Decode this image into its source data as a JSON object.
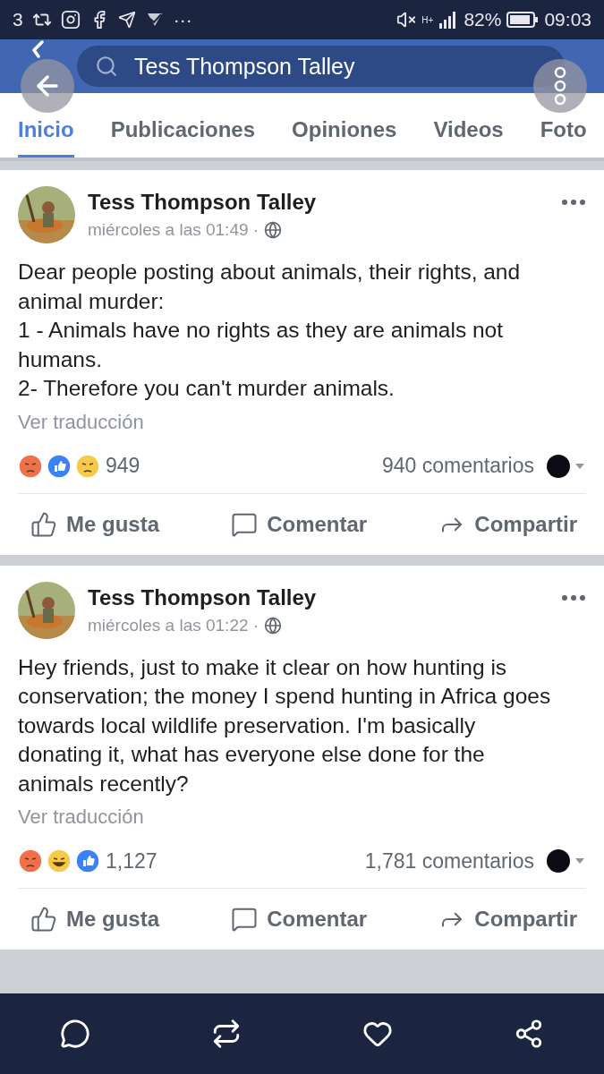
{
  "status_bar": {
    "notification_count": "3",
    "more": "···",
    "network": "H+",
    "battery": "82%",
    "time": "09:03"
  },
  "header": {
    "search": {
      "value": "Tess Thompson Talley"
    }
  },
  "tabs": [
    {
      "label": "Inicio",
      "selected": true
    },
    {
      "label": "Publicaciones",
      "selected": false
    },
    {
      "label": "Opiniones",
      "selected": false
    },
    {
      "label": "Videos",
      "selected": false
    },
    {
      "label": "Foto",
      "selected": false
    }
  ],
  "posts": [
    {
      "author": "Tess Thompson Talley",
      "time": "miércoles a las 01:49 ·",
      "lines": [
        "Dear people posting about animals, their rights, and animal murder:",
        "1 - Animals have no rights as they are animals not humans.",
        "2- Therefore you can't murder animals."
      ],
      "translate": "Ver traducción",
      "reactions": [
        {
          "kind": "angry"
        },
        {
          "kind": "like"
        },
        {
          "kind": "sad"
        }
      ],
      "reaction_count": "949",
      "comments": "940 comentarios",
      "actions": [
        "Me gusta",
        "Comentar",
        "Compartir"
      ]
    },
    {
      "author": "Tess Thompson Talley",
      "time": "miércoles a las 01:22 ·",
      "lines": [
        "Hey friends, just to make it clear on how hunting is conservation; the money I spend hunting in Africa goes towards local wildlife preservation. I'm basically donating it, what has everyone else done for the animals recently?"
      ],
      "translate": "Ver traducción",
      "reactions": [
        {
          "kind": "angry"
        },
        {
          "kind": "haha"
        },
        {
          "kind": "like"
        }
      ],
      "reaction_count": "1,127",
      "comments": "1,781 comentarios",
      "actions": [
        "Me gusta",
        "Comentar",
        "Compartir"
      ]
    }
  ]
}
